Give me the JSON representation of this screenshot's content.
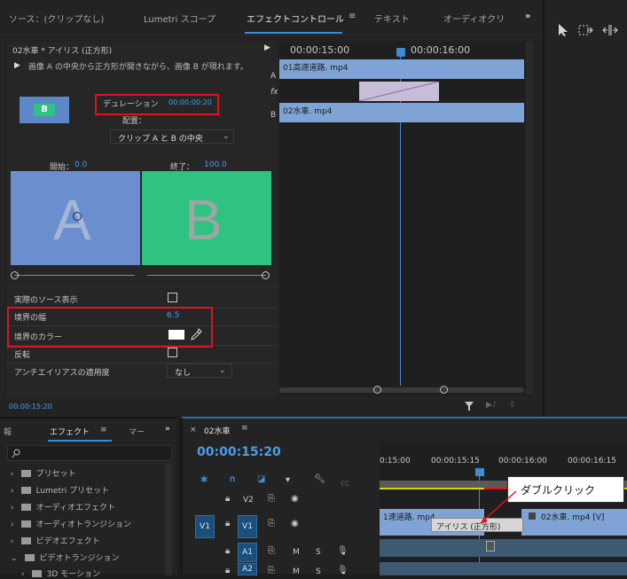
{
  "tabs": [
    {
      "label": "ソース：(クリップなし)"
    },
    {
      "label": "Lumetri スコープ"
    },
    {
      "label": "エフェクトコントロール"
    },
    {
      "label": "テキスト"
    },
    {
      "label": "オーディオクリ"
    }
  ],
  "tab_more": "»",
  "ec": {
    "clip_title": "02水車 * アイリス (正方形)",
    "description": "画像 A の中央から正方形が開きながら、画像 B が現れます。",
    "duration_label": "デュレーション",
    "duration_value": "00:00:00:20",
    "align_label": "配置：",
    "align_value": "クリップ A と B の中央",
    "start_label": "開始：",
    "start_value": "0.0",
    "end_label": "終了：",
    "end_value": "100.0",
    "preview_a": "A",
    "preview_b": "B",
    "show_source_label": "実際のソース表示",
    "border_width_label": "境界の幅",
    "border_width_value": "6.5",
    "border_color_label": "境界のカラー",
    "reverse_label": "反転",
    "antialias_label": "アンチエイリアスの適用度",
    "antialias_value": "なし",
    "timecode": "00:00:15:20"
  },
  "mini_timeline": {
    "time1": "00:00:15:00",
    "time2": "00:00:16:00",
    "track_a": "A",
    "track_b": "B",
    "fx_label": "fx",
    "clip_a": "01高速道路. mp4",
    "clip_b": "02水車. mp4"
  },
  "effects_panel": {
    "left_tab": "報",
    "tab": "エフェクト",
    "next_tab": "マー",
    "items": [
      {
        "label": "プリセット"
      },
      {
        "label": "Lumetri プリセット"
      },
      {
        "label": "オーディオエフェクト"
      },
      {
        "label": "オーディオトランジション"
      },
      {
        "label": "ビデオエフェクト"
      },
      {
        "label": "ビデオトランジション"
      },
      {
        "label": "3D モーション"
      }
    ]
  },
  "sequence": {
    "name": "02水車",
    "timecode": "00:00:15:20",
    "ruler": [
      "0:15:00",
      "00:00:15:15",
      "00:00:16:00",
      "00:00:16:15"
    ],
    "tracks": [
      "V2",
      "V1",
      "A1",
      "A2"
    ],
    "source_v1": "V1",
    "track_m": "M",
    "track_s": "S",
    "clip_v1_left": "1速道路. mp4",
    "clip_v1_right": "02水車. mp4 [V]",
    "transition_label": "アイリス (正方形)",
    "callout": "ダブルクリック"
  },
  "colors": {
    "accent": "#3c8dd6",
    "highlight": "#e0121a",
    "clip": "#7fa3d4",
    "preview_b": "#2fc382"
  }
}
